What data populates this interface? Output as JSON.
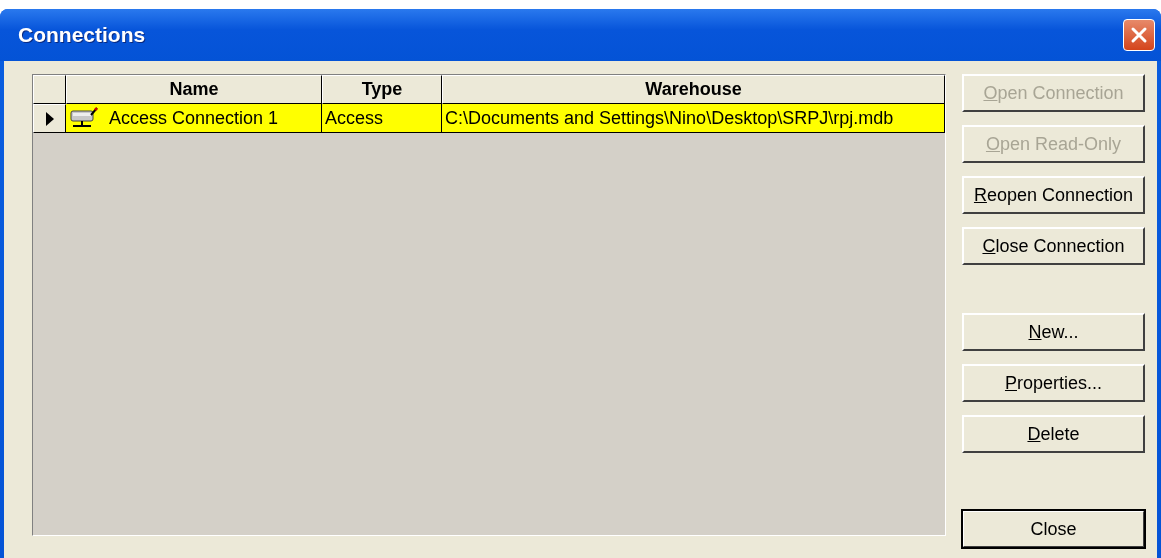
{
  "window": {
    "title": "Connections"
  },
  "table": {
    "columns": [
      "Name",
      "Type",
      "Warehouse"
    ],
    "rows": [
      {
        "selected": true,
        "cells": [
          "Access Connection 1",
          "Access",
          "C:\\Documents and Settings\\Nino\\Desktop\\SRPJ\\rpj.mdb"
        ]
      }
    ]
  },
  "button_groups": [
    [
      {
        "label": "Open Connection",
        "disabled": true,
        "access_key_first": true,
        "default": false
      },
      {
        "label": "Open Read-Only",
        "disabled": true,
        "access_key_first": true,
        "default": false
      },
      {
        "label": "Reopen Connection",
        "disabled": false,
        "access_key_first": true,
        "default": false
      },
      {
        "label": "Close Connection",
        "disabled": false,
        "access_key_first": true,
        "default": false
      }
    ],
    [
      {
        "label": "New...",
        "disabled": false,
        "access_key_first": true,
        "default": false
      },
      {
        "label": "Properties...",
        "disabled": false,
        "access_key_first": true,
        "default": false
      },
      {
        "label": "Delete",
        "disabled": false,
        "access_key_first": true,
        "default": false
      }
    ],
    [
      {
        "label": "Close",
        "disabled": false,
        "access_key_first": false,
        "default": true
      }
    ]
  ]
}
